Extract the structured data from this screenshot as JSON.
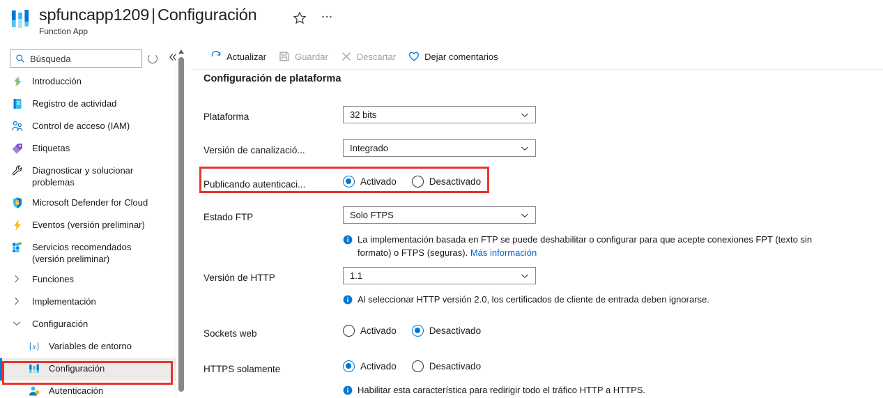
{
  "header": {
    "app_icon": "function-app-icon",
    "resource_name": "spfuncapp1209",
    "separator": "|",
    "blade_name": "Configuración",
    "subtitle": "Function App",
    "favorite_icon": "star-icon",
    "more_icon": "ellipsis-icon"
  },
  "search": {
    "placeholder": "Búsqueda",
    "icon": "search-icon",
    "refresh_icon": "circle-icon",
    "collapse_icon": "chevron-double-left-icon",
    "collapse_label": "«"
  },
  "sidebar": {
    "items": [
      {
        "label": "Introducción",
        "icon": "lightning-overview-icon",
        "type": "item",
        "selected": false
      },
      {
        "label": "Registro de actividad",
        "icon": "activity-log-icon",
        "type": "item",
        "selected": false
      },
      {
        "label": "Control de acceso (IAM)",
        "icon": "access-control-people-icon",
        "type": "item",
        "selected": false
      },
      {
        "label": "Etiquetas",
        "icon": "tag-icon",
        "type": "item",
        "selected": false
      },
      {
        "label": "Diagnosticar y solucionar problemas",
        "icon": "wrench-icon",
        "type": "item",
        "selected": false
      },
      {
        "label": "Microsoft Defender for Cloud",
        "icon": "shield-lock-icon",
        "type": "item",
        "selected": false
      },
      {
        "label": "Eventos (versión preliminar)",
        "icon": "bolt-icon",
        "type": "item",
        "selected": false
      },
      {
        "label": "Servicios recomendados (versión preliminar)",
        "icon": "grid-plus-icon",
        "type": "item",
        "selected": false
      },
      {
        "label": "Funciones",
        "icon": "chevron-right-icon",
        "type": "group-collapsed",
        "selected": false
      },
      {
        "label": "Implementación",
        "icon": "chevron-right-icon",
        "type": "group-collapsed",
        "selected": false
      },
      {
        "label": "Configuración",
        "icon": "chevron-down-icon",
        "type": "group-expanded",
        "selected": false
      },
      {
        "label": "Variables de entorno",
        "icon": "variables-icon",
        "type": "child",
        "selected": false
      },
      {
        "label": "Configuración",
        "icon": "function-app-icon",
        "type": "child",
        "selected": true
      },
      {
        "label": "Autenticación",
        "icon": "authentication-icon",
        "type": "child",
        "selected": false
      }
    ]
  },
  "toolbar": {
    "commands": [
      {
        "label": "Actualizar",
        "icon": "refresh-icon",
        "disabled": false
      },
      {
        "label": "Guardar",
        "icon": "save-disk-icon",
        "disabled": true
      },
      {
        "label": "Descartar",
        "icon": "close-x-icon",
        "disabled": true
      },
      {
        "label": "Dejar comentarios",
        "icon": "heart-feedback-icon",
        "disabled": false
      }
    ]
  },
  "main": {
    "section_title": "Configuración de plataforma",
    "fields": {
      "platform": {
        "label": "Plataforma",
        "control": "dropdown",
        "value": "32 bits",
        "caret_icon": "chevron-down-icon"
      },
      "pipeline_version": {
        "label": "Versión de canalizació...",
        "control": "dropdown",
        "value": "Integrado",
        "caret_icon": "chevron-down-icon"
      },
      "publishing_auth": {
        "label": "Publicando autenticaci...",
        "control": "radio",
        "options": [
          "Activado",
          "Desactivado"
        ],
        "selected": "Activado",
        "highlighted": true
      },
      "ftp_state": {
        "label": "Estado FTP",
        "control": "dropdown",
        "value": "Solo FTPS",
        "caret_icon": "chevron-down-icon",
        "info_icon": "info-circle-icon",
        "info_text": "La implementación basada en FTP se puede deshabilitar o configurar para que acepte conexiones FPT (texto sin formato) o FTPS (seguras).",
        "info_link": "Más información"
      },
      "http_version": {
        "label": "Versión de HTTP",
        "control": "dropdown",
        "value": "1.1",
        "caret_icon": "chevron-down-icon",
        "info_icon": "info-circle-icon",
        "info_text": "Al seleccionar HTTP versión 2.0, los certificados de cliente de entrada deben ignorarse."
      },
      "web_sockets": {
        "label": "Sockets web",
        "control": "radio",
        "options": [
          "Activado",
          "Desactivado"
        ],
        "selected": "Desactivado"
      },
      "https_only": {
        "label": "HTTPS solamente",
        "control": "radio",
        "options": [
          "Activado",
          "Desactivado"
        ],
        "selected": "Activado",
        "info_icon": "info-circle-icon",
        "info_text": "Habilitar esta característica para redirigir todo el tráfico HTTP a HTTPS."
      }
    }
  },
  "annotations": {
    "color": "#e8342a",
    "boxes": [
      "publicando-autenticacion-row",
      "sidebar-configuracion-item"
    ]
  },
  "colors": {
    "accent": "#0078d4",
    "annotation": "#e8342a",
    "link": "#0066cc",
    "selected_bg": "#edebe9"
  }
}
